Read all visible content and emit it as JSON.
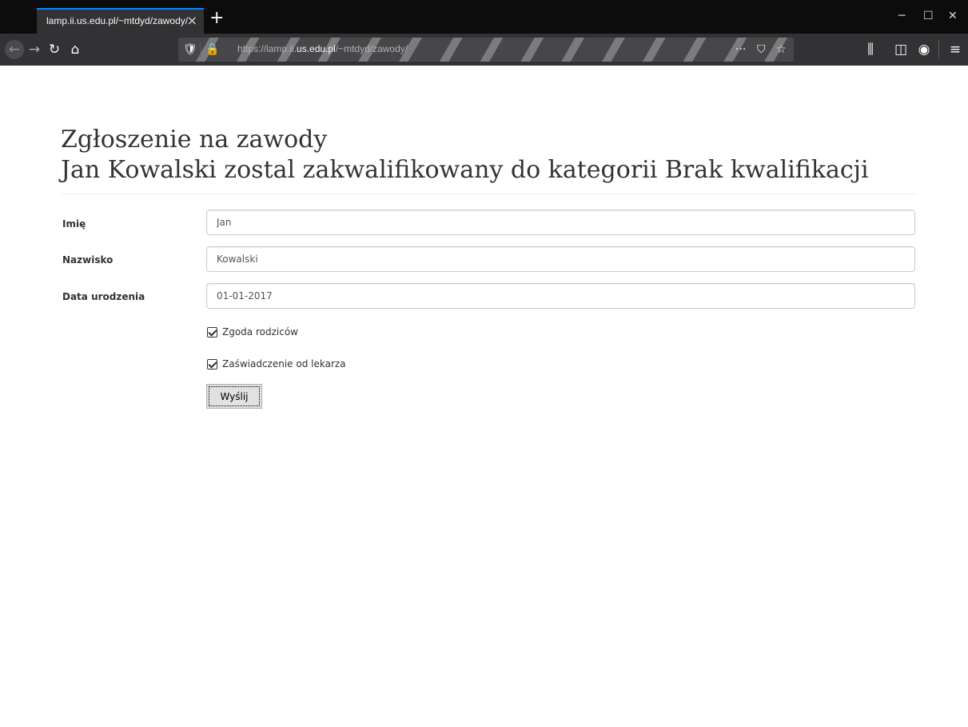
{
  "browser": {
    "tab_title": "lamp.ii.us.edu.pl/~mtdyd/zawody/",
    "tab_close": "×",
    "new_tab": "+",
    "url_prefix": "https://lamp.ii.",
    "url_host": "us.edu.pl",
    "url_path": "/~mtdyd/zawody/",
    "icons": {
      "back": "←",
      "forward": "→",
      "reload": "↻",
      "home": "⌂",
      "shield": "🛡",
      "lock": "🔒",
      "more": "···",
      "pocket": "⛉",
      "star": "☆",
      "library": "⫼",
      "sidebar": "◫",
      "account": "◉",
      "menu": "≡",
      "minimize": "─",
      "maximize": "☐",
      "close": "✕"
    }
  },
  "page": {
    "title_line1": "Zgłoszenie na zawody",
    "title_line2": "Jan Kowalski zostal zakwalifikowany do kategorii Brak kwalifikacji"
  },
  "form": {
    "fields": [
      {
        "label": "Imię",
        "value": "Jan"
      },
      {
        "label": "Nazwisko",
        "value": "Kowalski"
      },
      {
        "label": "Data urodzenia",
        "value": "01-01-2017"
      }
    ],
    "checkboxes": [
      {
        "label": "Zgoda rodziców",
        "checked": true
      },
      {
        "label": "Zaświadczenie od lekarza",
        "checked": true
      }
    ],
    "submit_label": "Wyślij"
  }
}
